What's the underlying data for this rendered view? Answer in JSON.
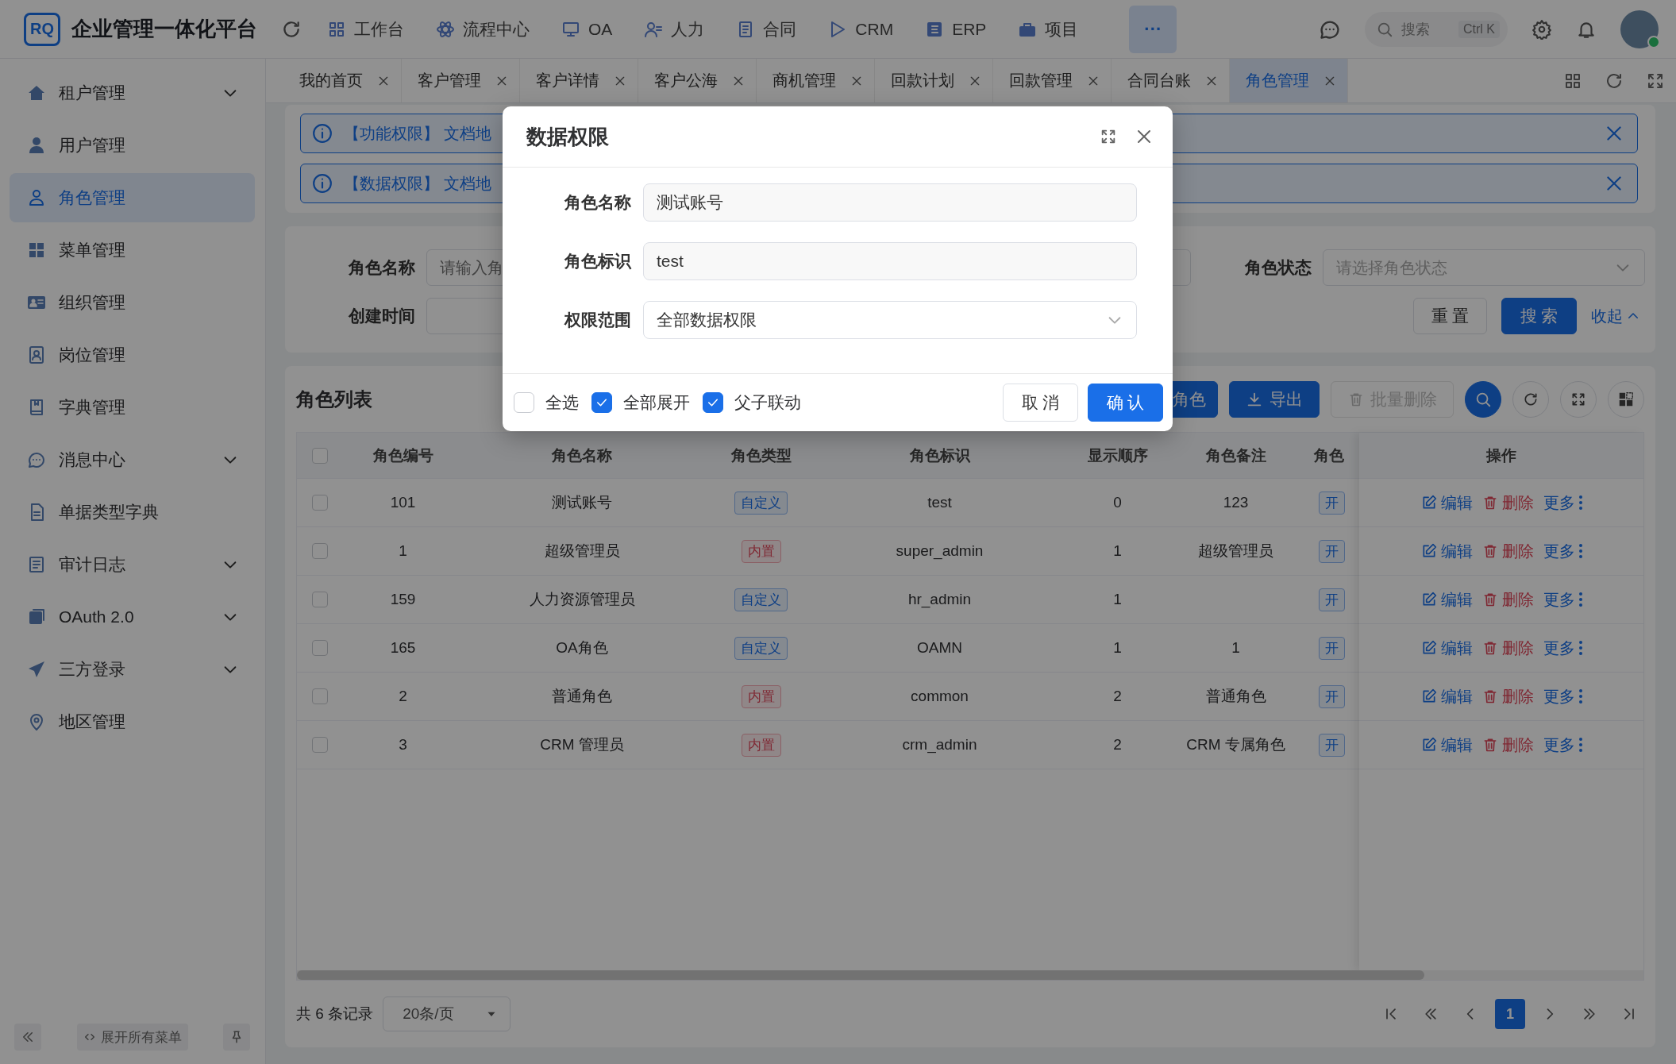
{
  "header": {
    "logo_text": "RQ",
    "title": "企业管理一体化平台",
    "nav": [
      {
        "label": "工作台"
      },
      {
        "label": "流程中心"
      },
      {
        "label": "OA"
      },
      {
        "label": "人力"
      },
      {
        "label": "合同"
      },
      {
        "label": "CRM"
      },
      {
        "label": "ERP"
      },
      {
        "label": "项目"
      }
    ],
    "more": "···",
    "search": {
      "placeholder": "搜索",
      "shortcut": "Ctrl K"
    }
  },
  "sidebar": {
    "items": [
      {
        "label": "租户管理",
        "kind": "group",
        "selected": false
      },
      {
        "label": "用户管理",
        "kind": "link",
        "selected": false
      },
      {
        "label": "角色管理",
        "kind": "link",
        "selected": true
      },
      {
        "label": "菜单管理",
        "kind": "link",
        "selected": false
      },
      {
        "label": "组织管理",
        "kind": "link",
        "selected": false
      },
      {
        "label": "岗位管理",
        "kind": "link",
        "selected": false
      },
      {
        "label": "字典管理",
        "kind": "link",
        "selected": false
      },
      {
        "label": "消息中心",
        "kind": "group",
        "selected": false
      },
      {
        "label": "单据类型字典",
        "kind": "link",
        "selected": false
      },
      {
        "label": "审计日志",
        "kind": "group",
        "selected": false
      },
      {
        "label": "OAuth 2.0",
        "kind": "group",
        "selected": false
      },
      {
        "label": "三方登录",
        "kind": "group",
        "selected": false
      },
      {
        "label": "地区管理",
        "kind": "link",
        "selected": false
      }
    ],
    "expand_all": "展开所有菜单"
  },
  "tabs": [
    {
      "label": "我的首页",
      "selected": false
    },
    {
      "label": "客户管理",
      "selected": false
    },
    {
      "label": "客户详情",
      "selected": false
    },
    {
      "label": "客户公海",
      "selected": false
    },
    {
      "label": "商机管理",
      "selected": false
    },
    {
      "label": "回款计划",
      "selected": false
    },
    {
      "label": "回款管理",
      "selected": false
    },
    {
      "label": "合同台账",
      "selected": false
    },
    {
      "label": "角色管理",
      "selected": true
    }
  ],
  "alerts": [
    {
      "text": "【功能权限】 文档地"
    },
    {
      "text": "【数据权限】 文档地"
    }
  ],
  "search_form": {
    "role_name": {
      "label": "角色名称",
      "placeholder": "请输入角"
    },
    "role_status": {
      "label": "角色状态",
      "placeholder": "请选择角色状态"
    },
    "create_time": {
      "label": "创建时间"
    },
    "reset": "重 置",
    "search": "搜 索",
    "collapse": "收起"
  },
  "table": {
    "title": "角色列表",
    "toolbar": {
      "add": "角色",
      "export": "导出",
      "batch_delete": {
        "label": "批量删除",
        "disabled": true
      }
    },
    "select_all_checked": false,
    "columns": [
      "角色编号",
      "角色名称",
      "角色类型",
      "角色标识",
      "显示顺序",
      "角色备注",
      "角色",
      "操作"
    ],
    "rows": [
      {
        "checked": false,
        "id": "101",
        "name": "测试账号",
        "type": {
          "label": "自定义",
          "kind": "custom"
        },
        "code": "test",
        "sort": "0",
        "remark": "123",
        "status": "开",
        "edit": "编辑",
        "delete": "删除",
        "more": "更多"
      },
      {
        "checked": false,
        "id": "1",
        "name": "超级管理员",
        "type": {
          "label": "内置",
          "kind": "builtin"
        },
        "code": "super_admin",
        "sort": "1",
        "remark": "超级管理员",
        "status": "开",
        "edit": "编辑",
        "delete": "删除",
        "more": "更多"
      },
      {
        "checked": false,
        "id": "159",
        "name": "人力资源管理员",
        "type": {
          "label": "自定义",
          "kind": "custom"
        },
        "code": "hr_admin",
        "sort": "1",
        "status": "开",
        "edit": "编辑",
        "delete": "删除",
        "more": "更多"
      },
      {
        "checked": false,
        "id": "165",
        "name": "OA角色",
        "type": {
          "label": "自定义",
          "kind": "custom"
        },
        "code": "OAMN",
        "sort": "1",
        "remark": "1",
        "status": "开",
        "edit": "编辑",
        "delete": "删除",
        "more": "更多"
      },
      {
        "checked": false,
        "id": "2",
        "name": "普通角色",
        "type": {
          "label": "内置",
          "kind": "builtin"
        },
        "code": "common",
        "sort": "2",
        "remark": "普通角色",
        "status": "开",
        "edit": "编辑",
        "delete": "删除",
        "more": "更多"
      },
      {
        "checked": false,
        "id": "3",
        "name": "CRM 管理员",
        "type": {
          "label": "内置",
          "kind": "builtin"
        },
        "code": "crm_admin",
        "sort": "2",
        "remark": "CRM 专属角色",
        "status": "开",
        "edit": "编辑",
        "delete": "删除",
        "more": "更多"
      }
    ],
    "pagination": {
      "total": "共 6 条记录",
      "page_size": "20条/页",
      "pages": [
        {
          "label": "1",
          "selected": true
        }
      ]
    }
  },
  "dialog": {
    "title": "数据权限",
    "fields": [
      {
        "label": "角色名称",
        "value": "测试账号",
        "kind": "input"
      },
      {
        "label": "角色标识",
        "value": "test",
        "kind": "input"
      },
      {
        "label": "权限范围",
        "value": "全部数据权限",
        "kind": "select"
      }
    ],
    "checks": [
      {
        "label": "全选",
        "checked": false
      },
      {
        "label": "全部展开",
        "checked": true
      },
      {
        "label": "父子联动",
        "checked": true
      }
    ],
    "cancel": "取 消",
    "confirm": "确 认"
  }
}
